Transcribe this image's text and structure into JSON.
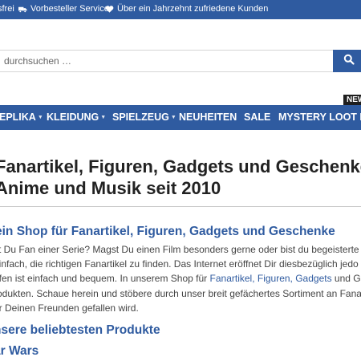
{
  "colors": {
    "brand": "#2f5ba0",
    "new_badge": "#1f1f1f"
  },
  "topbar": {
    "items": [
      {
        "icon": "truck-icon",
        "label": "sfrei"
      },
      {
        "icon": "truck-icon",
        "label": "Vorbesteller Service"
      },
      {
        "icon": "heart-icon",
        "label": "Über ein Jahrzehnt zufriedene Kunden"
      }
    ]
  },
  "search": {
    "placeholder": "durchsuchen …",
    "button_icon": "search-icon"
  },
  "new_badge": "NEW",
  "nav": {
    "items": [
      {
        "label": "EPLIKA",
        "has_dropdown": true
      },
      {
        "label": "KLEIDUNG",
        "has_dropdown": true
      },
      {
        "label": "SPIELZEUG",
        "has_dropdown": true
      },
      {
        "label": "NEUHEITEN",
        "has_dropdown": false
      },
      {
        "label": "SALE",
        "has_dropdown": false
      },
      {
        "label": "MYSTERY LOOT BO",
        "has_dropdown": false
      }
    ]
  },
  "main": {
    "title_line1": "Fanartikel, Figuren, Gadgets und Geschenke",
    "title_line2": "Anime und Musik seit 2010",
    "section_heading": "ein Shop für Fanartikel, Figuren, Gadgets und Geschenke",
    "paragraph": {
      "line1": "st Du Fan einer Serie? Magst Du einen Film besonders gerne oder bist du begeisterte",
      "line2": "einfach, die richtigen Fanartikel zu finden. Das Internet eröffnet Dir diesbezüglich jedo",
      "line3_before": "ufen ist einfach und bequem. In unserem Shop für ",
      "line3_link": "Fanartikel, Figuren, Gadgets",
      "line3_after": " und Ge",
      "line4": "rodukten. Schaue herein und stöbere durch unser breit gefächertes Sortiment an Fanar",
      "line5": "er Deinen Freunden gefallen wird."
    },
    "popular_heading": "nsere beliebtesten Produkte",
    "category_heading": "ar Wars"
  }
}
